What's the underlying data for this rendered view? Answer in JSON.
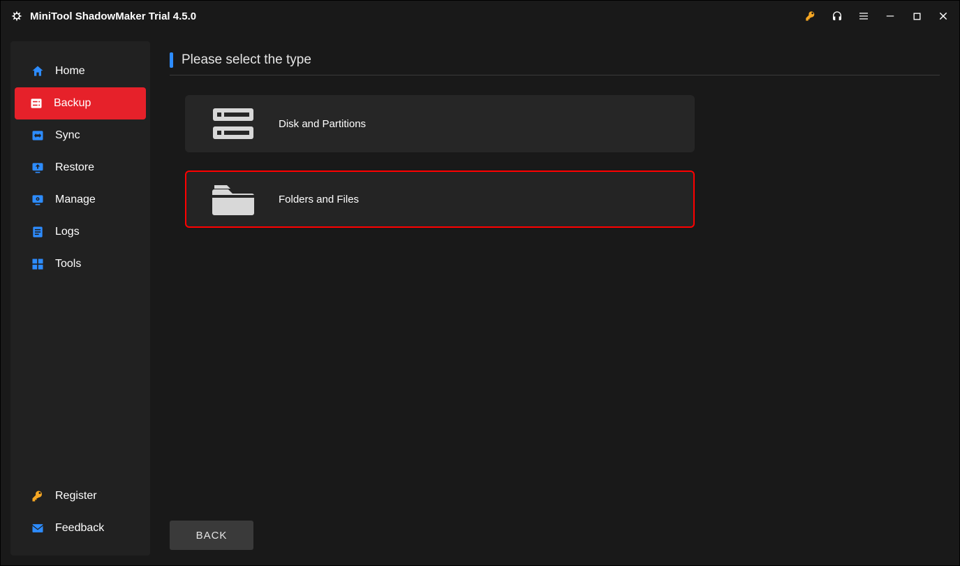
{
  "titlebar": {
    "title": "MiniTool ShadowMaker Trial 4.5.0"
  },
  "sidebar": {
    "items": [
      {
        "label": "Home"
      },
      {
        "label": "Backup"
      },
      {
        "label": "Sync"
      },
      {
        "label": "Restore"
      },
      {
        "label": "Manage"
      },
      {
        "label": "Logs"
      },
      {
        "label": "Tools"
      }
    ],
    "register_label": "Register",
    "feedback_label": "Feedback"
  },
  "main": {
    "section_title": "Please select the type",
    "options": [
      {
        "label": "Disk and Partitions"
      },
      {
        "label": "Folders and Files"
      }
    ],
    "back_label": "BACK"
  }
}
